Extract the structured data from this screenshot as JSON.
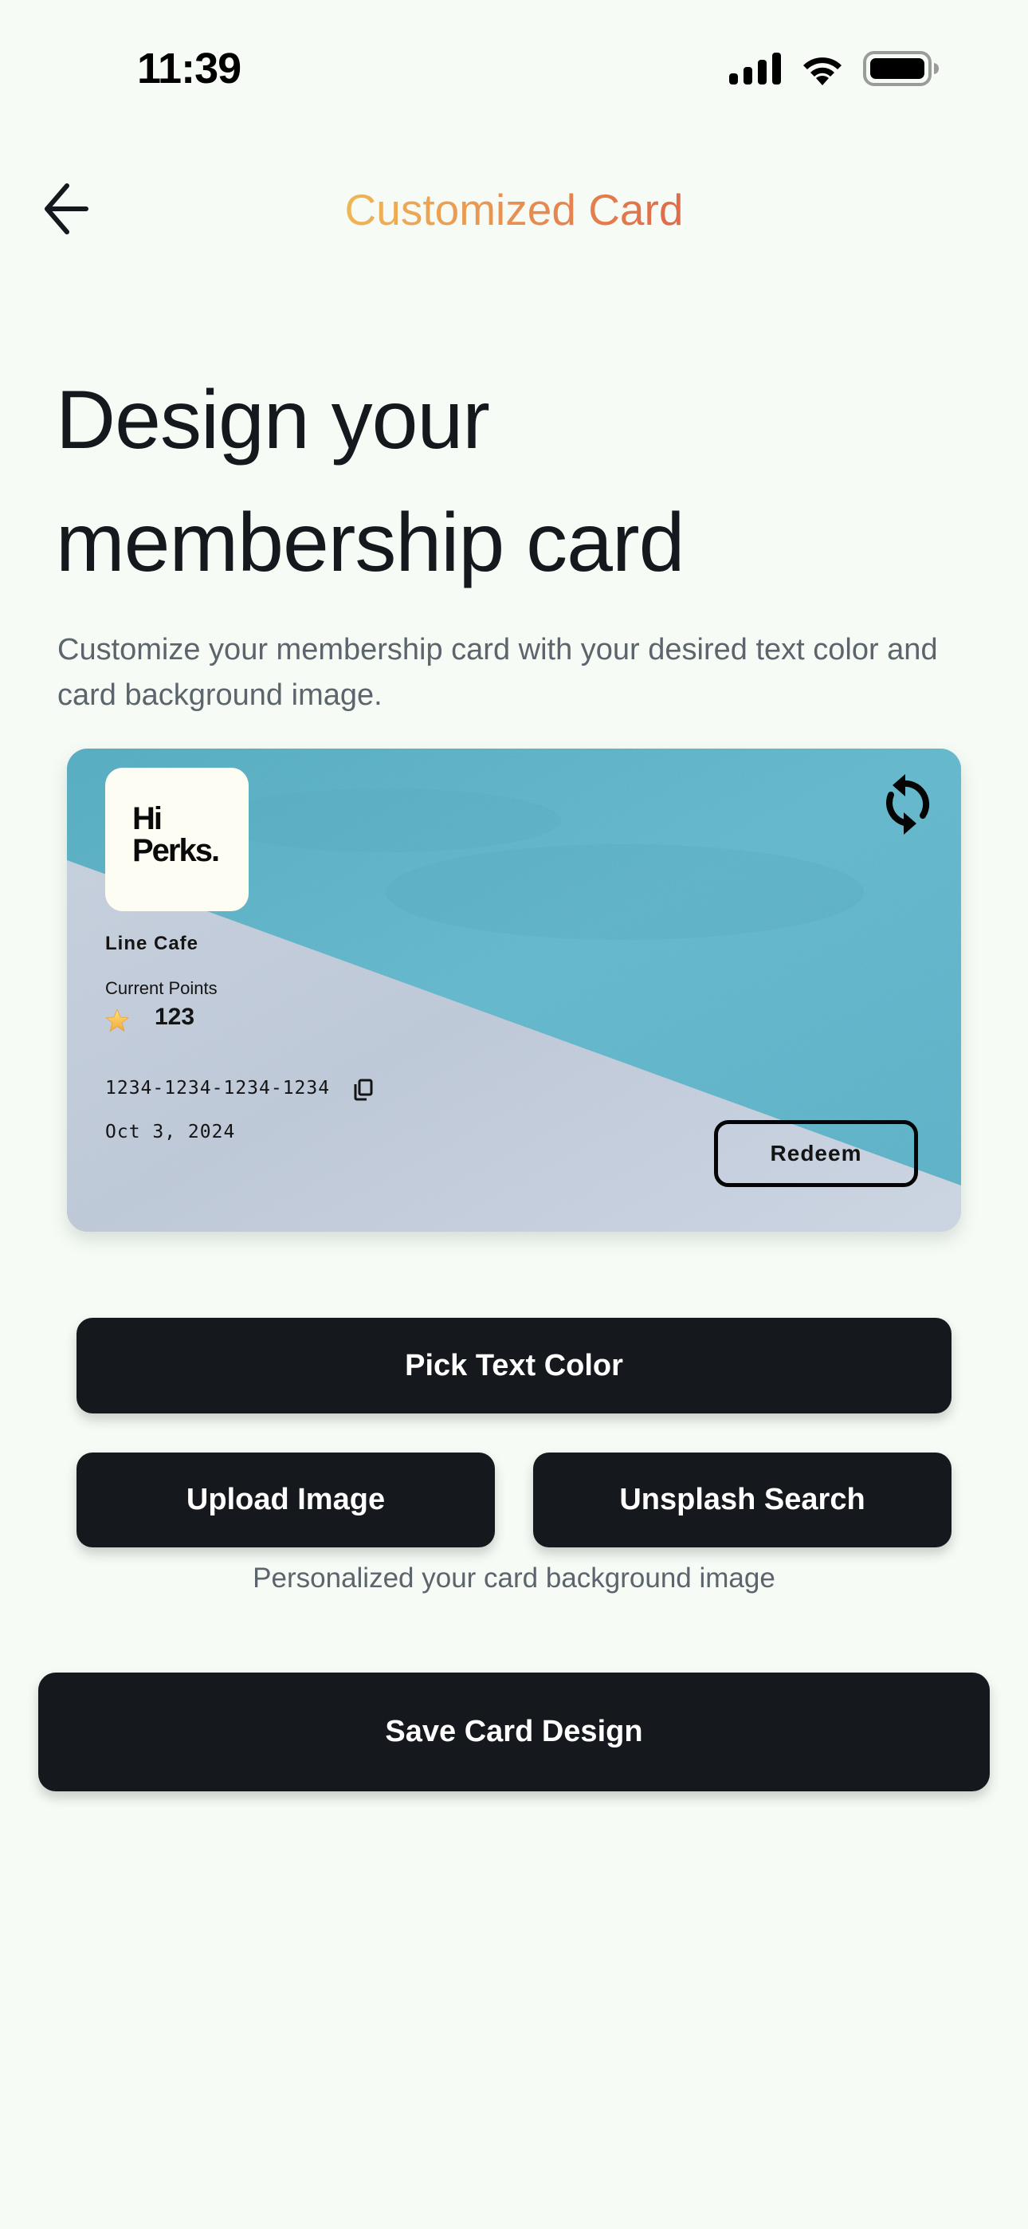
{
  "status_bar": {
    "time": "11:39",
    "icons": [
      "cellular-signal-icon",
      "wifi-icon",
      "battery-icon"
    ]
  },
  "nav": {
    "back_icon": "arrow-left-icon",
    "title": "Customized Card",
    "title_gradient": [
      "#EFB556",
      "#E06B4A"
    ]
  },
  "header": {
    "title_line1": "Design your",
    "title_line2": "membership card",
    "subtitle": "Customize your membership card with your desired text color and card background image."
  },
  "card": {
    "logo_line1": "Hi",
    "logo_line2": "Perks.",
    "refresh_icon": "refresh-icon",
    "merchant_name": "Line Cafe",
    "points_label": "Current Points",
    "points_icon": "star-icon",
    "points_value": "123",
    "card_number": "1234-1234-1234-1234",
    "copy_icon": "copy-icon",
    "date": "Oct 3, 2024",
    "redeem_label": "Redeem",
    "colors": {
      "water": "#5AB1C6",
      "stone": "#BFCAD9",
      "text": "#141414"
    }
  },
  "actions": {
    "pick_text_color": "Pick Text Color",
    "upload_image": "Upload Image",
    "unsplash_search": "Unsplash Search",
    "caption": "Personalized your card background image",
    "save": "Save Card Design"
  },
  "colors": {
    "background": "#F6FBF6",
    "button": "#15191D",
    "muted_text": "#5C646C"
  }
}
